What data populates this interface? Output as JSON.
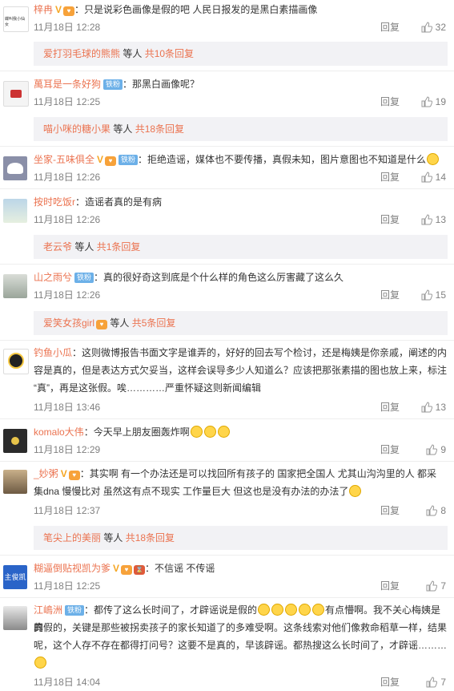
{
  "comments": [
    {
      "user": "梓冉",
      "text": "：只是说彩色画像是假的吧 人民日报发的是黑白素描画像",
      "date": "11月18日 12:28",
      "reply": "回复",
      "likes": "32"
    },
    {
      "user": "萬耳是一条好狗",
      "badge": "铁粉",
      "text": "：那黑白画像呢？",
      "date": "11月18日 12:25",
      "reply": "回复",
      "likes": "19"
    },
    {
      "user": "坐家-五味俱全",
      "text": "：拒绝造谣，媒体也不要传播，真假未知，图片意图也不知道是什么",
      "date": "11月18日 12:26",
      "reply": "回复",
      "likes": "14"
    },
    {
      "user": "按时吃饭r",
      "text": "：造谣者真的是有病",
      "date": "11月18日 12:26",
      "reply": "回复",
      "likes": "13"
    },
    {
      "user": "山之雨兮",
      "badge": "铁粉",
      "text": "：真的很好奇这到底是个什么样的角色这么厉害藏了这么久",
      "date": "11月18日 12:26",
      "reply": "回复",
      "likes": "15"
    },
    {
      "user": "钓鱼小瓜",
      "text_lines": [
        "：这则微博报告书面文字是谁弄的，好好的回去写个检讨，还是梅姨是你亲戚，阐述的内",
        "容是真的，但是表达方式欠妥当，这样会误导多少人知道么？应该把那张素描的图也放上来，标注",
        "“真”，再是这张假。唉…………严重怀疑这则新闻编辑"
      ],
      "date": "11月18日 13:46",
      "reply": "回复",
      "likes": "13"
    },
    {
      "user": "komalo大伟",
      "text": "：今天早上朋友圈轰炸啊",
      "date": "11月18日 12:29",
      "reply": "回复",
      "likes": "9"
    },
    {
      "user": "_妙粥",
      "text_lines": [
        "：其实啊 有一个办法还是可以找回所有孩子的 国家把全国人 尤其山沟沟里的人 都采",
        "集dna 慢慢比对 虽然这有点不现实 工作量巨大 但这也是没有办法的办法了"
      ],
      "date": "11月18日 12:37",
      "reply": "回复",
      "likes": "8"
    },
    {
      "user": "糊逼倒贴视凯为爹",
      "text": "：不信谣 不传谣",
      "date": "11月18日 12:25",
      "reply": "回复",
      "likes": "7"
    },
    {
      "user": "江嶋洲",
      "badge": "铁粉",
      "text_lines": [
        "：都传了这么长时间了，才辟谣说是假的",
        "有点懵啊。我不关心梅姨是真",
        "的假的，关键是那些被拐卖孩子的家长知道了的多难受啊。这条线索对他们像救命稻草一样，结果",
        "呢，这个人存不存在都得打问号？这要不是真的，早该辟谣。都热搜这么长时间了，才辟谣………"
      ],
      "date": "11月18日 14:04",
      "reply": "回复",
      "likes": "7"
    }
  ],
  "subs": [
    {
      "user": "爱打羽毛球的熊熊",
      "mid": " 等人 ",
      "count": "共10条回复"
    },
    {
      "user": "喵小咪的糖小果",
      "mid": " 等人 ",
      "count": "共18条回复"
    },
    {
      "user": "老云爷",
      "mid": " 等人 ",
      "count": "共1条回复"
    },
    {
      "user": "爱笑女孩girl",
      "mid": " 等人 ",
      "count": "共5条回复"
    },
    {
      "user": "笔尖上的美丽",
      "mid": " 等人 ",
      "count": "共18条回复"
    }
  ],
  "colors": {
    "username": "#eb7350",
    "meta": "#808080",
    "subbg": "#f2f2f5"
  }
}
